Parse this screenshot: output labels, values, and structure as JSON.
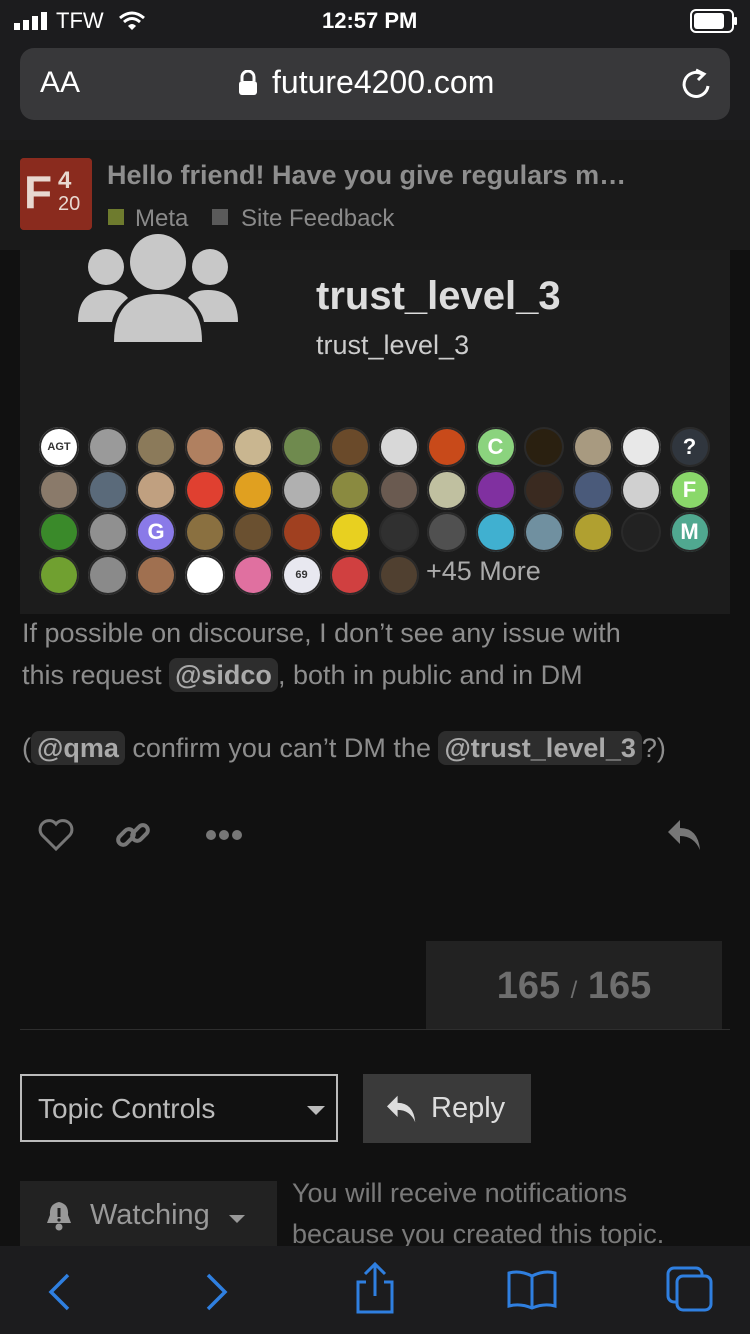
{
  "status": {
    "carrier": "TFW",
    "time": "12:57 PM"
  },
  "browser": {
    "text_size_label": "AA",
    "url": "future4200.com"
  },
  "topic": {
    "title": "Hello friend! Have you give regulars m…",
    "category": "Meta",
    "subcategory": "Site Feedback",
    "category_color": "#6e7b2e",
    "subcategory_color": "#5a5a5a",
    "logo_text": "F420"
  },
  "group_card": {
    "name": "trust_level_3",
    "full_name": "trust_level_3",
    "more_label": "+45 More",
    "avatars": [
      {
        "color": "#ffffff",
        "letter": "AGT"
      },
      {
        "color": "#9a9a9a",
        "letter": ""
      },
      {
        "color": "#8b7a5a",
        "letter": ""
      },
      {
        "color": "#b08060",
        "letter": ""
      },
      {
        "color": "#c9b690",
        "letter": ""
      },
      {
        "color": "#6f8a4e",
        "letter": ""
      },
      {
        "color": "#6a4a2a",
        "letter": ""
      },
      {
        "color": "#d8d8d8",
        "letter": ""
      },
      {
        "color": "#c84a1a",
        "letter": ""
      },
      {
        "color": "#8bd37e",
        "letter": "C"
      },
      {
        "color": "#2a2010",
        "letter": ""
      },
      {
        "color": "#a89a80",
        "letter": ""
      },
      {
        "color": "#e8e8e8",
        "letter": ""
      },
      {
        "color": "#30363e",
        "letter": "?"
      },
      {
        "color": "#8a7a6a",
        "letter": ""
      },
      {
        "color": "#5a6a7a",
        "letter": ""
      },
      {
        "color": "#c0a080",
        "letter": ""
      },
      {
        "color": "#e04030",
        "letter": ""
      },
      {
        "color": "#e0a020",
        "letter": ""
      },
      {
        "color": "#b0b0b0",
        "letter": ""
      },
      {
        "color": "#8a8a40",
        "letter": ""
      },
      {
        "color": "#6a5a50",
        "letter": ""
      },
      {
        "color": "#c0c0a0",
        "letter": ""
      },
      {
        "color": "#8030a0",
        "letter": ""
      },
      {
        "color": "#3a2a20",
        "letter": ""
      },
      {
        "color": "#4a5a7a",
        "letter": ""
      },
      {
        "color": "#d0d0d0",
        "letter": ""
      },
      {
        "color": "#8ad86a",
        "letter": "F"
      },
      {
        "color": "#3a8a2a",
        "letter": ""
      },
      {
        "color": "#909090",
        "letter": ""
      },
      {
        "color": "#8a7ae8",
        "letter": "G"
      },
      {
        "color": "#8a7040",
        "letter": ""
      },
      {
        "color": "#6a5030",
        "letter": ""
      },
      {
        "color": "#a04020",
        "letter": ""
      },
      {
        "color": "#e8d020",
        "letter": ""
      },
      {
        "color": "#303030",
        "letter": ""
      },
      {
        "color": "#505050",
        "letter": ""
      },
      {
        "color": "#40b0d0",
        "letter": ""
      },
      {
        "color": "#7090a0",
        "letter": ""
      },
      {
        "color": "#b0a030",
        "letter": ""
      },
      {
        "color": "#222222",
        "letter": ""
      },
      {
        "color": "#50a890",
        "letter": "M"
      },
      {
        "color": "#70a030",
        "letter": ""
      },
      {
        "color": "#8a8a8a",
        "letter": ""
      },
      {
        "color": "#a07050",
        "letter": ""
      },
      {
        "color": "#ffffff",
        "letter": ""
      },
      {
        "color": "#e070a0",
        "letter": ""
      },
      {
        "color": "#e8e8f0",
        "letter": "69"
      },
      {
        "color": "#d04040",
        "letter": ""
      },
      {
        "color": "#504030",
        "letter": ""
      }
    ]
  },
  "post": {
    "line1": "If possible on discourse, I don’t see any issue with",
    "line2_a": "this request ",
    "mention1": "@sidco",
    "line2_b": ", both in public and in DM",
    "line3_a": "(",
    "mention2": "@qma",
    "line3_b": " confirm you can’t DM the ",
    "mention3": "@trust_level_3",
    "line3_c": "?)"
  },
  "progress": {
    "current": "165",
    "separator": "/",
    "total": "165"
  },
  "controls": {
    "topic_controls_label": "Topic Controls",
    "reply_label": "Reply",
    "watching_label": "Watching",
    "notification_text_1": "You will receive notifications",
    "notification_text_2": "because you created this topic."
  }
}
